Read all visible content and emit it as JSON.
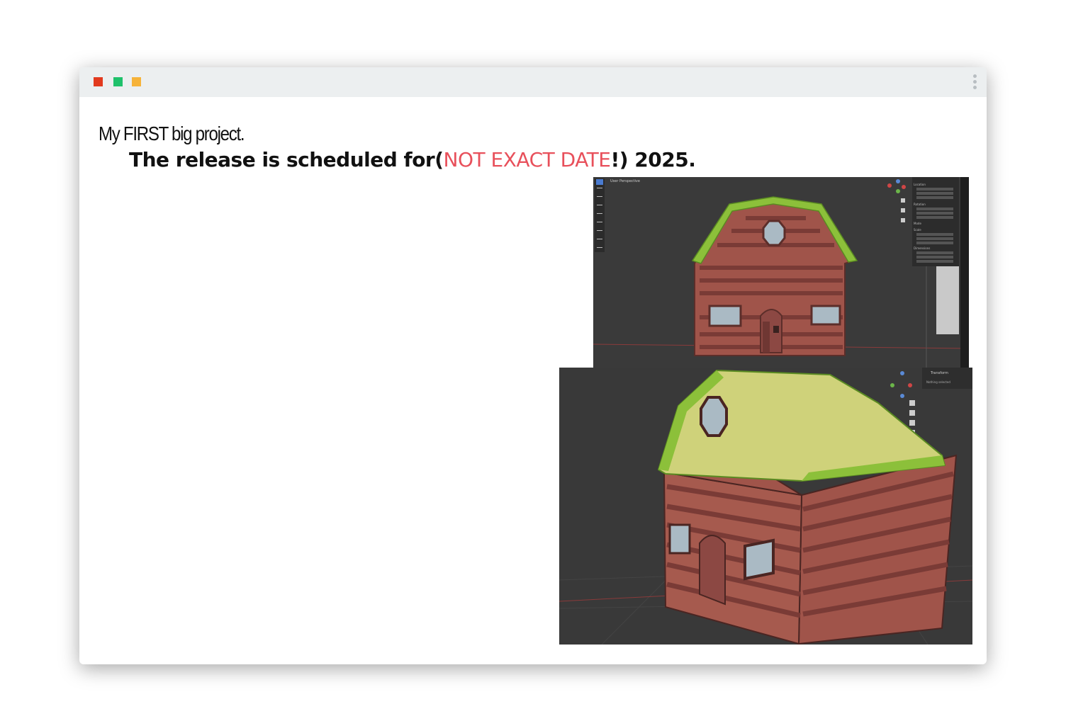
{
  "window": {
    "controls": [
      {
        "name": "close",
        "color": "#e23a1e"
      },
      {
        "name": "maximize",
        "color": "#1fc16b"
      },
      {
        "name": "minimize",
        "color": "#f6b33a"
      }
    ],
    "menu_icon": "vertical-ellipsis-icon"
  },
  "post": {
    "title": "My FIRST big project.",
    "line_prefix": "The release is scheduled for(",
    "line_highlight": "NOT EXACT DATE",
    "line_suffix": "!) 2025.",
    "highlight_color": "#e8505b"
  },
  "viewport_top": {
    "view_label": "User Perspective",
    "panel_sections": [
      "Location",
      "Rotation",
      "Mode",
      "Scale",
      "Dimensions"
    ]
  },
  "viewport_bottom": {
    "panel_title": "Transform",
    "panel_text": "Nothing selected"
  },
  "colors": {
    "viewport_bg": "#393939",
    "wall": "#a3554a",
    "roof": "#8cbe3c",
    "window_glass": "#a9b9c3"
  }
}
